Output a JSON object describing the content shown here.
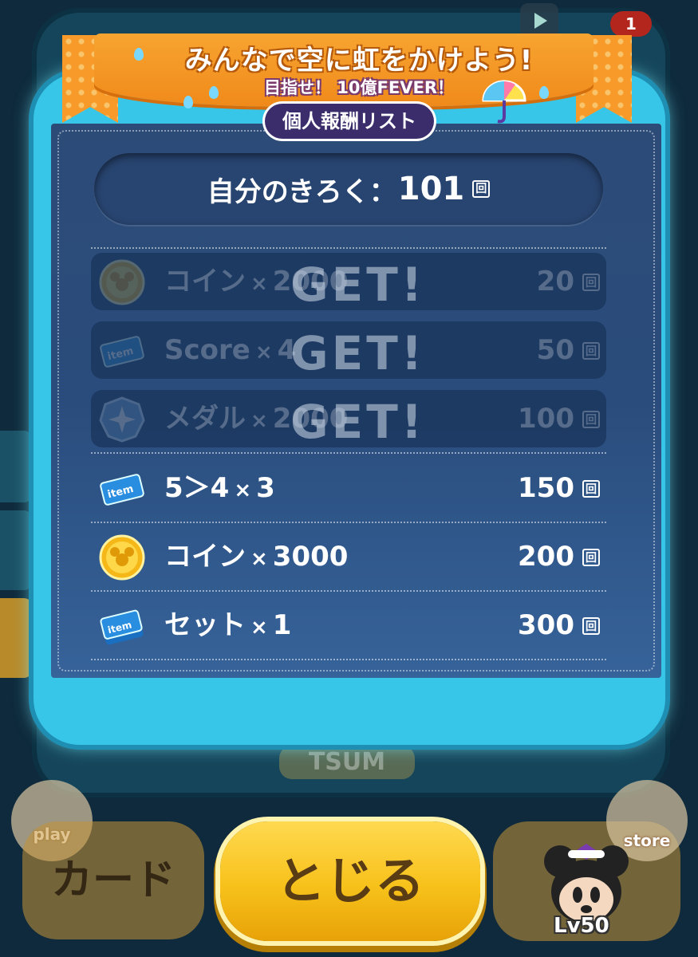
{
  "background": {
    "badge_count": "1",
    "logo_text": "TSUM"
  },
  "banner": {
    "title": "みんなで空に虹をかけよう!",
    "subtitle": "目指せ！ 10億FEVER！",
    "list_label": "個人報酬リスト"
  },
  "record": {
    "label": "自分のきろく：",
    "value": "101",
    "unit": "回"
  },
  "rewards": [
    {
      "icon": "coin-icon",
      "name": "コイン",
      "times": "×",
      "amount": "2000",
      "count": "20",
      "unit": "回",
      "obtained": true,
      "stamp": "GET!"
    },
    {
      "icon": "item-ticket-icon",
      "name": "Score",
      "times": "×",
      "amount": "4",
      "count": "50",
      "unit": "回",
      "obtained": true,
      "stamp": "GET!"
    },
    {
      "icon": "medal-icon",
      "name": "メダル",
      "times": "×",
      "amount": "2000",
      "count": "100",
      "unit": "回",
      "obtained": true,
      "stamp": "GET!"
    },
    {
      "icon": "item-ticket-icon",
      "name": "5＞4",
      "times": "×",
      "amount": "3",
      "count": "150",
      "unit": "回",
      "obtained": false,
      "stamp": ""
    },
    {
      "icon": "coin-icon",
      "name": "コイン",
      "times": "×",
      "amount": "3000",
      "count": "200",
      "unit": "回",
      "obtained": false,
      "stamp": ""
    },
    {
      "icon": "item-ticket-set-icon",
      "name": "セット",
      "times": "×",
      "amount": "1",
      "count": "300",
      "unit": "回",
      "obtained": false,
      "stamp": ""
    }
  ],
  "bottom": {
    "close_label": "とじる",
    "card_label": "カード",
    "play_label": "play",
    "store_label": "store",
    "level": "Lv50"
  },
  "colors": {
    "dialog_frame": "#38c6e8",
    "panel": "#2d4b77",
    "banner": "#f7a431",
    "close_button": "#f7c11a"
  }
}
